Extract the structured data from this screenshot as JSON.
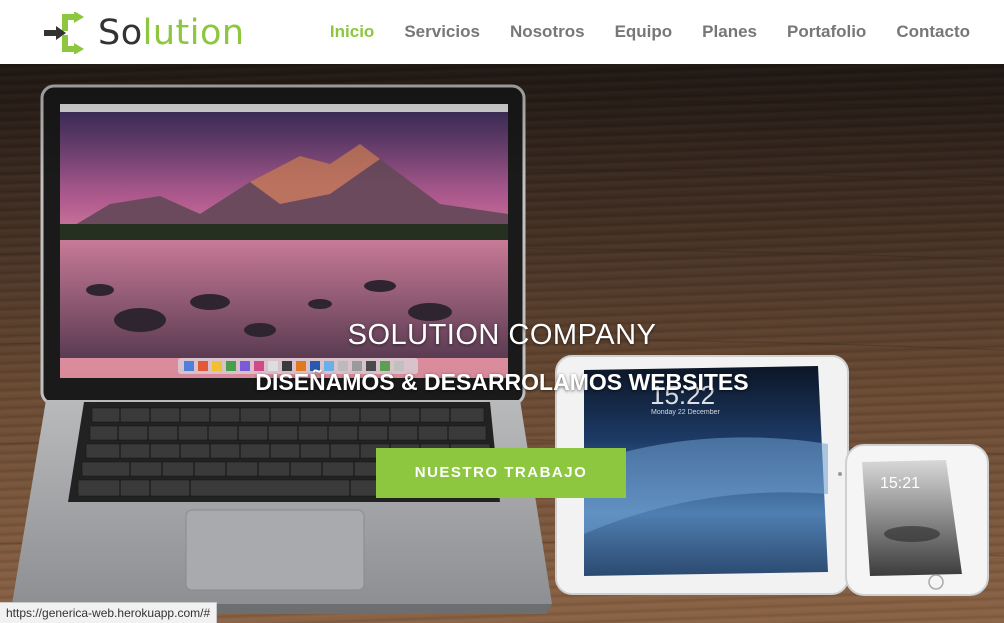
{
  "brand": {
    "logo_prefix": "So",
    "logo_suffix": "lution",
    "primary_color": "#8dc63f",
    "dark_color": "#333333"
  },
  "nav": {
    "items": [
      {
        "label": "Inicio",
        "active": true
      },
      {
        "label": "Servicios",
        "active": false
      },
      {
        "label": "Nosotros",
        "active": false
      },
      {
        "label": "Equipo",
        "active": false
      },
      {
        "label": "Planes",
        "active": false
      },
      {
        "label": "Portafolio",
        "active": false
      },
      {
        "label": "Contacto",
        "active": false
      }
    ]
  },
  "hero": {
    "title": "SOLUTION COMPANY",
    "subtitle": "DISEÑAMOS & DESARROLAMOS WEBSITES",
    "button_label": "NUESTRO TRABAJO",
    "tablet_time": "15:22",
    "tablet_date": "Monday 22 December",
    "phone_time": "15:21"
  },
  "status_bar": {
    "url": "https://generica-web.herokuapp.com/#"
  }
}
